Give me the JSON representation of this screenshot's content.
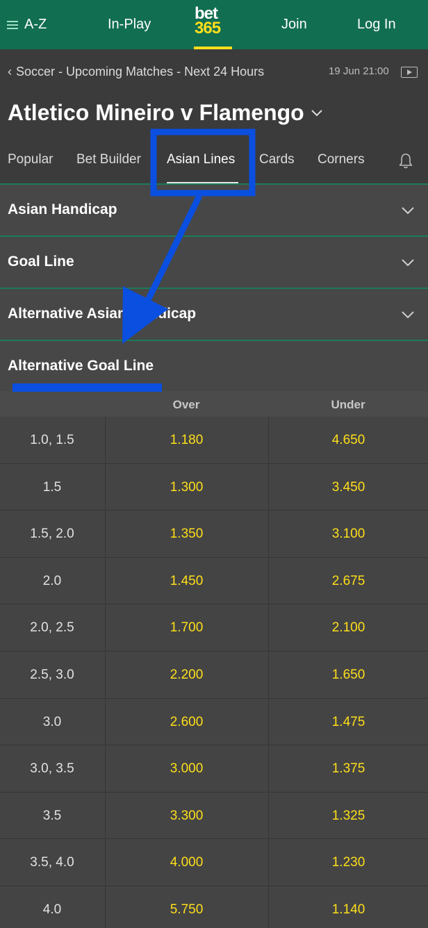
{
  "topbar": {
    "az_label": "A-Z",
    "inplay_label": "In-Play",
    "logo_line1": "bet",
    "logo_line2": "365",
    "join_label": "Join",
    "login_label": "Log In"
  },
  "header": {
    "breadcrumb": "Soccer - Upcoming Matches - Next 24 Hours",
    "datetime": "19 Jun 21:00",
    "match_title": "Atletico Mineiro v Flamengo"
  },
  "tabs": [
    "Popular",
    "Bet Builder",
    "Asian Lines",
    "Cards",
    "Corners"
  ],
  "active_tab": "Asian Lines",
  "markets": [
    {
      "title": "Asian Handicap"
    },
    {
      "title": "Goal Line"
    },
    {
      "title": "Alternative Asian Handicap"
    },
    {
      "title": "Alternative Goal Line"
    }
  ],
  "table": {
    "headers": {
      "over": "Over",
      "under": "Under"
    },
    "rows": [
      {
        "line": "1.0, 1.5",
        "over": "1.180",
        "under": "4.650"
      },
      {
        "line": "1.5",
        "over": "1.300",
        "under": "3.450"
      },
      {
        "line": "1.5, 2.0",
        "over": "1.350",
        "under": "3.100"
      },
      {
        "line": "2.0",
        "over": "1.450",
        "under": "2.675"
      },
      {
        "line": "2.0, 2.5",
        "over": "1.700",
        "under": "2.100"
      },
      {
        "line": "2.5, 3.0",
        "over": "2.200",
        "under": "1.650"
      },
      {
        "line": "3.0",
        "over": "2.600",
        "under": "1.475"
      },
      {
        "line": "3.0, 3.5",
        "over": "3.000",
        "under": "1.375"
      },
      {
        "line": "3.5",
        "over": "3.300",
        "under": "1.325"
      },
      {
        "line": "3.5, 4.0",
        "over": "4.000",
        "under": "1.230"
      },
      {
        "line": "4.0",
        "over": "5.750",
        "under": "1.140"
      }
    ]
  },
  "colors": {
    "brand_green": "#126e51",
    "odds_yellow": "#ffdf1b",
    "annotation_blue": "#0a4fe0"
  }
}
